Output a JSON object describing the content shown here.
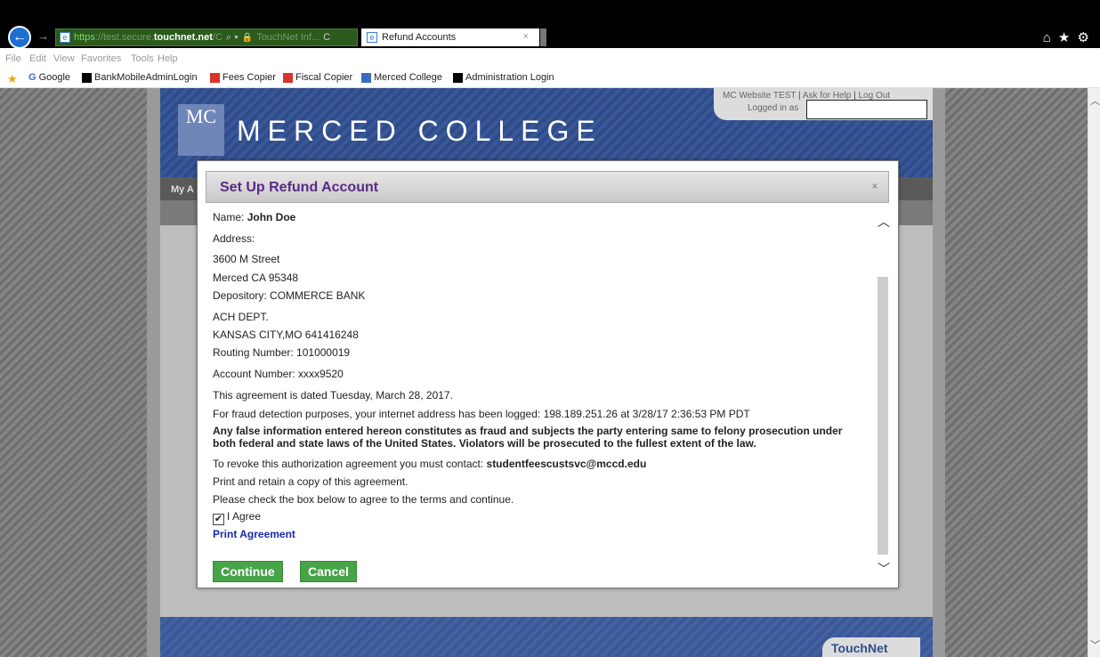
{
  "browser": {
    "address": {
      "https": "https",
      "host_prefix": "://test.secure.",
      "host": "touchnet.net",
      "path": "/C",
      "search_dropdown": "⌕ ▾",
      "lock": "🔒",
      "cert": "TouchNet Inf...",
      "refresh": "C"
    },
    "tab": {
      "title": "Refund Accounts",
      "close": "×"
    },
    "right_icons": "⌂ ★ ⚙",
    "menu": [
      "File",
      "Edit",
      "View",
      "Favorites",
      "Tools",
      "Help"
    ],
    "favorites": [
      {
        "label": "Google",
        "icon": "G",
        "color": "#3b6bd6"
      },
      {
        "label": "BankMobileAdminLogin",
        "icon": "",
        "color": "#000000"
      },
      {
        "label": "Fees Copier",
        "icon": "",
        "color": "#d9342b"
      },
      {
        "label": "Fiscal Copier",
        "icon": "",
        "color": "#d9342b"
      },
      {
        "label": "Merced College",
        "icon": "",
        "color": "#3a6bbf"
      },
      {
        "label": "Administration Login",
        "icon": "",
        "color": "#000000"
      }
    ]
  },
  "site": {
    "name": "MERCED COLLEGE",
    "logo": "MC",
    "util": {
      "site_label": "MC Website TEST",
      "help": "Ask for Help",
      "logout": "Log Out",
      "logged_in": "Logged in as"
    },
    "nav_label": "My A",
    "footer_logo": "TouchNet"
  },
  "modal": {
    "title": "Set Up Refund Account",
    "close": "×",
    "name_label": "Name:",
    "name_value": "John Doe",
    "address_label": "Address:",
    "address_line1": "3600 M Street",
    "address_line2": "Merced CA 95348",
    "depository": "Depository: COMMERCE BANK",
    "bank_line1": "ACH DEPT.",
    "bank_line2": "KANSAS CITY,MO 641416248",
    "routing": "Routing Number: 101000019",
    "account": "Account Number: xxxx9520",
    "dated": "This agreement is dated Tuesday, March 28, 2017.",
    "fraud": "For fraud detection purposes, your internet address has been logged: 198.189.251.26 at 3/28/17 2:36:53 PM PDT",
    "warning": "Any false information entered hereon constitutes as fraud and subjects the party entering same to felony prosecution under both federal and state laws of the United States. Violators will be prosecuted to the fullest extent of the law.",
    "revoke_prefix": "To revoke this authorization agreement you must contact:",
    "revoke_email": "studentfeescustsvc@mccd.edu",
    "print_retain": "Print and retain a copy of this agreement.",
    "check_instruction": "Please check the box below to agree to the terms and continue.",
    "agree_label": "I Agree",
    "agree_checked": true,
    "print_link": "Print Agreement",
    "continue_label": "Continue",
    "cancel_label": "Cancel"
  }
}
